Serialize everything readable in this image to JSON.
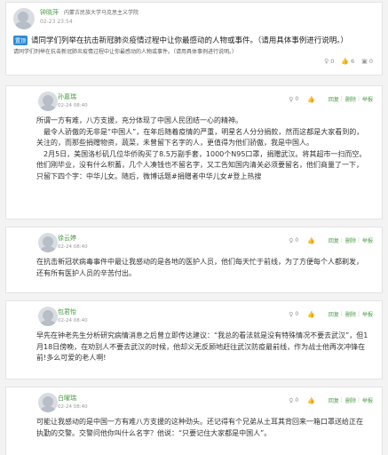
{
  "question": {
    "author": "钟晓萍",
    "school": "内蒙古民族大学马克思主义学院",
    "time": "02-23 23:54",
    "tag": "置顶",
    "title": "请同学们列举在抗击新冠肺炎疫情过程中让你最感动的人物或事件。（请用具体事例进行说明。）",
    "subtitle": "请同学们列举在抗击新冠肺炎疫情过程中让你最感动的人物或事件。（请用具体事例进行说明。）",
    "stats": {
      "likes": "0",
      "answers": "6",
      "comments": "0"
    }
  },
  "actions": {
    "reply": "回复",
    "delete": "删除",
    "report": "举报"
  },
  "answers": [
    {
      "author": "孙嘉瑞",
      "time": "02-24 08:40",
      "likes": "0",
      "paragraphs": [
        "所谓一方有难，八方支援，充分体现了中国人民团结一心的精神。",
        "最令人骄傲的无非是“中国人”，在年后随着疫情的严重，明星名人分分捐款，然而这都是大家看到的，关注的，而那些捐赠物资，蔬菜，未曾留下名字的人，更值得为他们骄傲，我是中国人。",
        "2月5日，美国洛杉矶几位华侨购买了8.5万副手套，1000个N95口罩，捐赠武汉。将其超市一扫而空。他们刚毕业，没有什么积蓄，几个人凑钱也不留名字，又工告知国内清关必须要留名，他们商量了一下，只留下四个字：中华儿女。随后，微博话题#捐赠者中华儿女#登上热搜"
      ]
    },
    {
      "author": "徐云婷",
      "time": "02-24 08:40",
      "likes": "0",
      "paragraphs": [
        "在抗击新冠状病毒事件中最让我感动的是各地的医护人员，他们每天忙于前线，为了方便每个人都剃发，还有所有医护人员的辛苦付出。"
      ]
    },
    {
      "author": "包君怡",
      "time": "02-24 08:40",
      "likes": "0",
      "paragraphs": [
        "早先在钟老先生分析研究病情消息之后曾立即传达建议：“我总的看法就是没有特殊情况不要去武汉”，但1月18日傍晚，在劝别人不要去武汉的时候，他却义无反顾地赶往武汉防疫最前线，作为战士他再次冲锋在前!多么可爱的老人啊!"
      ]
    },
    {
      "author": "白曜瑞",
      "time": "02-24 08:40",
      "likes": "0",
      "paragraphs": [
        "可能让我感动的是中国一方有难八方支援的这种劲头。还记得有个兄弟从土耳其背回来一箱口罩送给正在执勤的交警。交警问他你叫什么名字？他说：“只要记住大家都是中国人”。"
      ]
    }
  ]
}
